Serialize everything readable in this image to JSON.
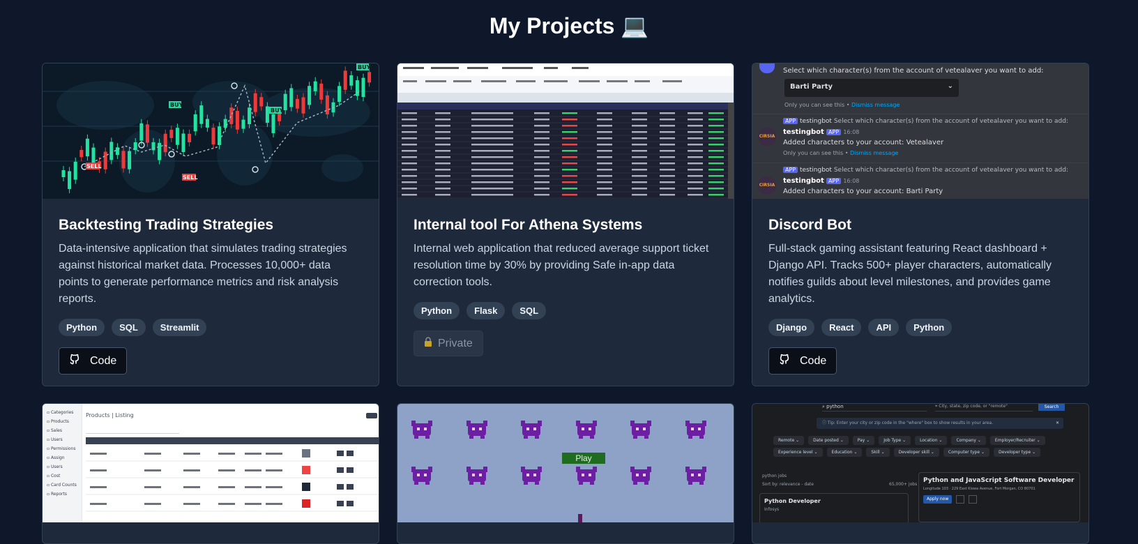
{
  "page": {
    "title": "My Projects 💻"
  },
  "projects": [
    {
      "title": "Backtesting Trading Strategies",
      "description": "Data-intensive application that simulates trading strategies against historical market data. Processes 10,000+ data points to generate performance metrics and risk analysis reports.",
      "tags": [
        "Python",
        "SQL",
        "Streamlit"
      ],
      "button": "Code",
      "icon": "github-icon",
      "thumb": {
        "labels": [
          "BUY",
          "BUY",
          "BUY",
          "SELL",
          "SELL",
          "BUY"
        ]
      }
    },
    {
      "title": "Internal tool For Athena Systems",
      "description": "Internal web application that reduced average support ticket resolution time by 30% by providing Safe in-app data correction tools.",
      "tags": [
        "Python",
        "Flask",
        "SQL"
      ],
      "button": "Private",
      "icon": "lock-icon"
    },
    {
      "title": "Discord Bot",
      "description": "Full-stack gaming assistant featuring React dashboard + Django API. Tracks 500+ player characters, automatically notifies guilds about level milestones, and provides game analytics.",
      "tags": [
        "Django",
        "React",
        "API",
        "Python"
      ],
      "button": "Code",
      "icon": "github-icon",
      "thumb": {
        "prompt": "Select which character(s) from the account of vetealaver you want to add:",
        "select_value": "Barti Party",
        "ephemeral": "Only you can see this •",
        "dismiss": "Dismiss message",
        "app_badge": "APP",
        "bot_name": "testingbot",
        "time": "16:08",
        "msg1": "Added characters to your account: Vetealaver",
        "msg2": "Added characters to your account: Barti Party",
        "avatar_text": "CIRSIA"
      }
    },
    {
      "thumb": {
        "heading": "Products | Listing",
        "sidebar": [
          "Categories",
          "Products",
          "Sales",
          "Users",
          "Permissions",
          "Assign",
          "Users",
          "Cost",
          "Card Counts",
          "Reports"
        ]
      }
    },
    {
      "thumb": {
        "play_label": "Play"
      }
    },
    {
      "thumb": {
        "search_value": "python",
        "location_placeholder": "City, state, zip code, or \"remote\"",
        "search_button": "Search",
        "tip": "Tip: Enter your city or zip code in the \"where\" box to show results in your area.",
        "filters": [
          "Remote",
          "Date posted",
          "Pay",
          "Job Type",
          "Location",
          "Company",
          "Employer/Recruiter",
          "Experience level",
          "Education",
          "Skill",
          "Developer skill",
          "Computer type",
          "Developer type"
        ],
        "results_label": "python jobs",
        "sort_label": "Sort by: relevance - date",
        "count": "65,000+ jobs",
        "job_left": "Python Developer",
        "job_left_company": "Infosys",
        "job_right": "Python and JavaScript Software Developer",
        "job_right_company": "Longitude 103 · 229 East Kiowa Avenue, Fort Morgan, CO 80701",
        "apply": "Apply now"
      }
    }
  ]
}
